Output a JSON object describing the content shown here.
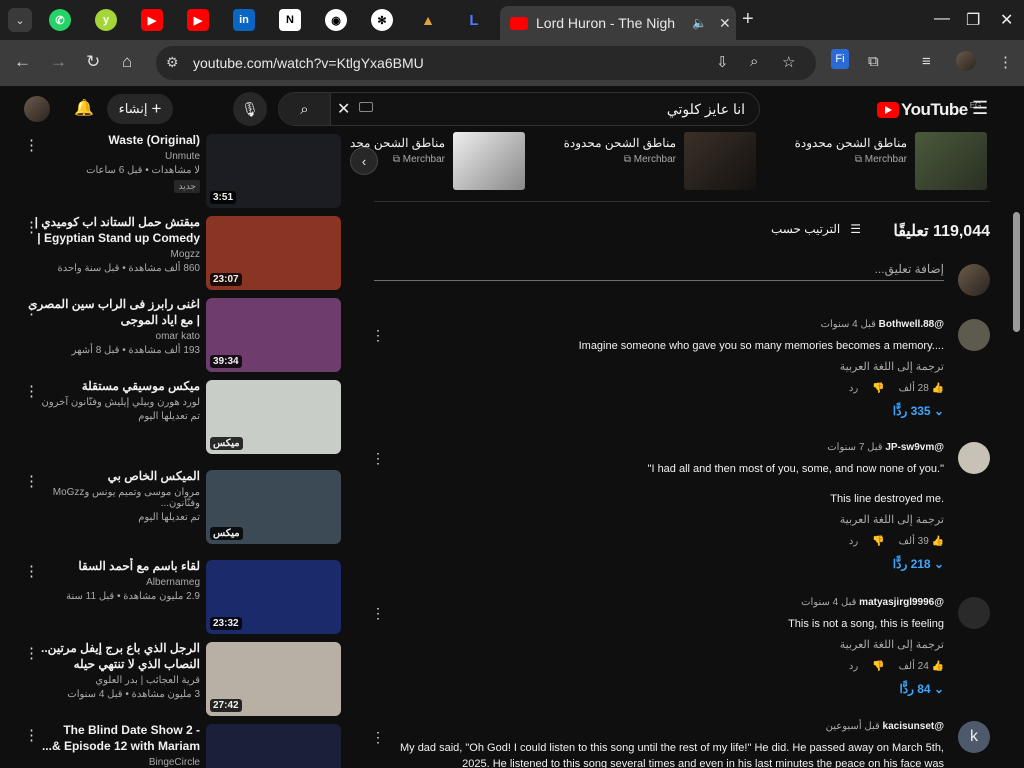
{
  "browser": {
    "tab_title": "Lord Huron - The Nigh",
    "url": "youtube.com/watch?v=KtlgYxa6BMU",
    "pinned_tabs": [
      "whatsapp-icon",
      "y-icon",
      "youtube-icon",
      "youtube-icon",
      "linkedin-icon",
      "notion-icon",
      "github-icon",
      "openai-icon",
      "pyramid-icon",
      "l-icon"
    ]
  },
  "masthead": {
    "create_label": "إنشاء",
    "search_query": "انا عايز كلوتي",
    "logo": "YouTube",
    "region": "EG"
  },
  "sidebar": {
    "videos": [
      {
        "title": "Waste (Original)",
        "channel": "Unmute",
        "stats": "لا مشاهدات • قبل 6 ساعات",
        "badge": "جديد",
        "duration": "3:51",
        "thumb_color": "#1b1d22"
      },
      {
        "title": "مبقتش حمل الستاند اب كوميدي | Egyptian Stand up Comedy | ه...",
        "channel": "Mogzz",
        "stats": "860 ألف مشاهدة • قبل سنة واحدة",
        "duration": "23:07",
        "thumb_color": "#8a3424"
      },
      {
        "title": "اغنى رابرز فى الراب سين المصرى | مع اياد الموجى",
        "channel": "omar kato",
        "stats": "193 ألف مشاهدة • قبل 8 أشهر",
        "duration": "39:34",
        "thumb_color": "#6e3d6e"
      },
      {
        "title": "ميكس موسيقي مستقلة",
        "channel": "لورد هورن وبيلي إيليش وفنّانون آخرون",
        "stats": "تم تعديلها اليوم",
        "duration": "ميكس",
        "thumb_color": "#c9cdc8"
      },
      {
        "title": "الميكس الخاص بي",
        "channel": "مروان موسى وتميم يونس وMoGzz وفنّانون...",
        "stats": "تم تعديلها اليوم",
        "duration": "ميكس",
        "thumb_color": "#3c4a55"
      },
      {
        "title": "لقاء باسم مع أحمد السقا",
        "channel": "Albernameg",
        "stats": "2.9 مليون مشاهدة • قبل 11 سنة",
        "duration": "23:32",
        "thumb_color": "#1b2a6a"
      },
      {
        "title": "الرجل الذي باع برج إيفل مرتين.. النصاب الذي لا تنتهي حيله",
        "channel": "قرية العجائب | بدر العلوي",
        "stats": "3 مليون مشاهدة • قبل 4 سنوات",
        "duration": "27:42",
        "thumb_color": "#b8b0a4"
      },
      {
        "title": "The Blind Date Show 2 - Episode 12 with Mariam &...",
        "channel": "BingeCircle",
        "stats": "",
        "duration": "",
        "thumb_color": "#1c1f3a"
      }
    ]
  },
  "merch": {
    "items": [
      {
        "title": "مناطق الشحن محدودة",
        "seller": "Merchbar"
      },
      {
        "title": "مناطق الشحن محدودة",
        "seller": "Merchbar"
      },
      {
        "title": "مناطق الشحن محدو",
        "seller": "Merchbar"
      }
    ]
  },
  "comments_section": {
    "count_label": "119,044 تعليقًا",
    "sort_label": "الترتيب حسب",
    "add_placeholder": "إضافة تعليق...",
    "comments": [
      {
        "author": "@Bothwell.88",
        "time": "قبل 4 سنوات",
        "text": "Imagine someone who gave you so many memories becomes a memory....",
        "translate": "ترجمة إلى اللغة العربية",
        "likes": "28 ألف",
        "reply": "رد",
        "replies": "335 ردًّا",
        "avatar_color": "#5d5a4e"
      },
      {
        "author": "@JP-sw9vm",
        "time": "قبل 7 سنوات",
        "text": "\"I had all and then most of you, some, and now none of you.\"",
        "text2": "This line destroyed me.",
        "translate": "ترجمة إلى اللغة العربية",
        "likes": "39 ألف",
        "reply": "رد",
        "replies": "218 ردًّا",
        "avatar_color": "#c8c2b6"
      },
      {
        "author": "@matyasjirgl9996",
        "time": "قبل 4 سنوات",
        "text": "This is not a song, this is feeling",
        "translate": "ترجمة إلى اللغة العربية",
        "likes": "24 ألف",
        "reply": "رد",
        "replies": "84 ردًّا",
        "avatar_color": "#2a2a2a"
      },
      {
        "author": "@kacisunset",
        "time": "قبل أسبوعين",
        "text": "My dad said, \"Oh God! I could listen to this song until the rest of my life!\"  He did.  He passed away on March 5th, 2025.  He listened to this song several times and even in his last minutes the peace on his face was",
        "avatar_letter": "k",
        "avatar_color": "#4e5a6c"
      }
    ]
  }
}
